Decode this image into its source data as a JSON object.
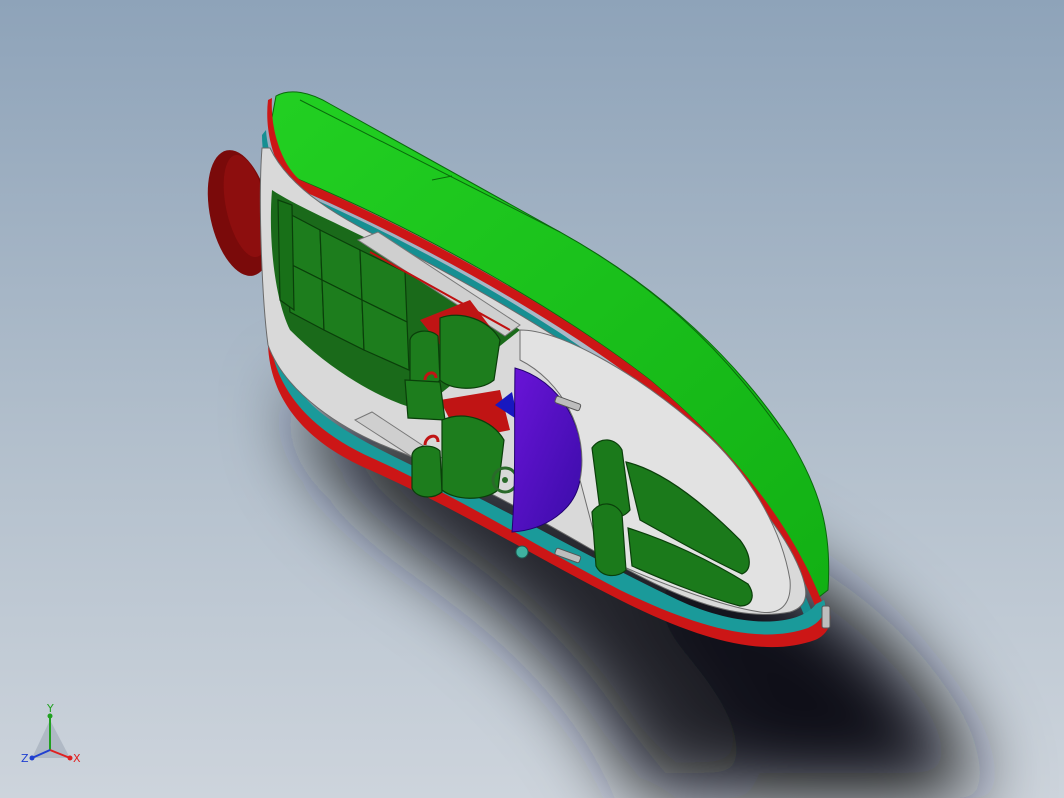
{
  "triad": {
    "x_label": "X",
    "y_label": "Y",
    "z_label": "Z",
    "x_color": "#e02020",
    "y_color": "#20a020",
    "z_color": "#2040d0"
  },
  "colors": {
    "background_top": "#8da2b8",
    "background_bottom": "#c9d1da",
    "hull": "#19c21a",
    "hull_edge": "#0e8a10",
    "rub_strip": "#d01818",
    "teal_band": "#1a9a9a",
    "deck": "#dcdcdc",
    "seat": "#167a16",
    "windshield": "#5a10c8",
    "shadow": "#1b1f25"
  }
}
